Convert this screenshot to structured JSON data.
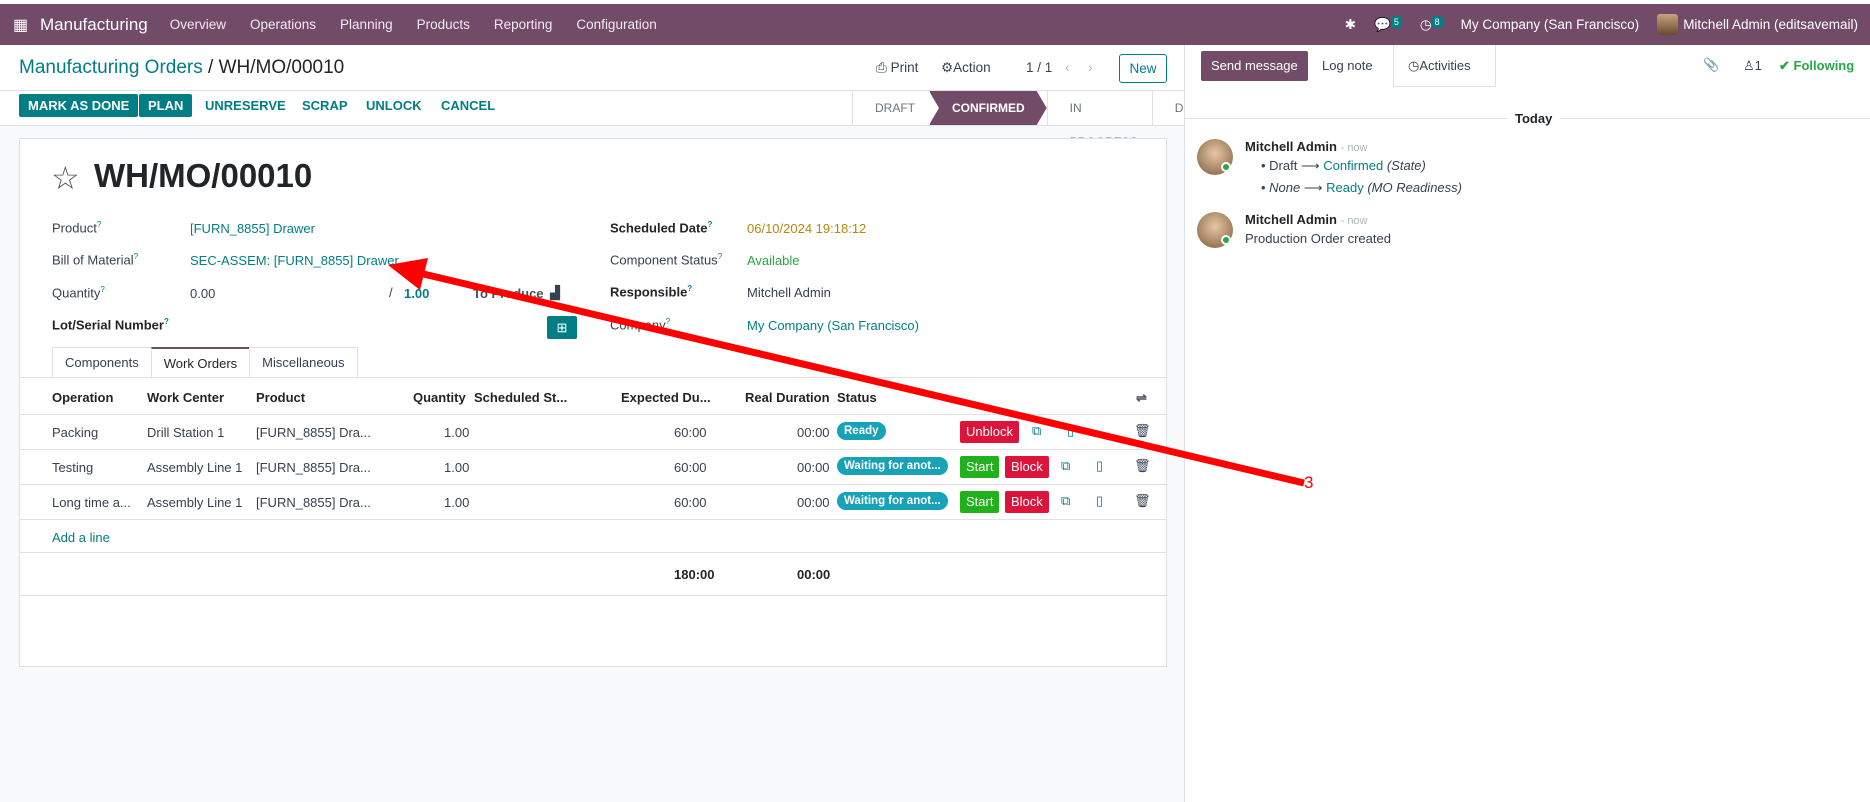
{
  "topbar": {
    "app_name": "Manufacturing",
    "menu": [
      "Overview",
      "Operations",
      "Planning",
      "Products",
      "Reporting",
      "Configuration"
    ],
    "chat_count": "5",
    "activity_count": "8",
    "company": "My Company (San Francisco)",
    "user": "Mitchell Admin (editsavemail)"
  },
  "control": {
    "breadcrumb_parent": "Manufacturing Orders",
    "breadcrumb_sep": "/",
    "breadcrumb_current": "WH/MO/00010",
    "print": "Print",
    "action": "Action",
    "pager": "1 / 1",
    "new": "New"
  },
  "actions": [
    "MARK AS DONE",
    "PLAN",
    "UNRESERVE",
    "SCRAP",
    "UNLOCK",
    "CANCEL"
  ],
  "stages": [
    "DRAFT",
    "CONFIRMED",
    "IN PROGRESS",
    "DONE"
  ],
  "form": {
    "title": "WH/MO/00010",
    "product_label": "Product",
    "product": "[FURN_8855] Drawer",
    "bom_label": "Bill of Material",
    "bom": "SEC-ASSEM: [FURN_8855] Drawer",
    "qty_label": "Quantity",
    "qty_done": "0.00",
    "qty_sep": "/",
    "qty_total": "1.00",
    "to_produce": "To Produce",
    "lot_label": "Lot/Serial Number",
    "sched_label": "Scheduled Date",
    "sched": "06/10/2024 19:18:12",
    "comp_status_label": "Component Status",
    "comp_status": "Available",
    "resp_label": "Responsible",
    "resp": "Mitchell Admin",
    "company_label": "Company",
    "company": "My Company (San Francisco)"
  },
  "tabs": [
    "Components",
    "Work Orders",
    "Miscellaneous"
  ],
  "table": {
    "headers": [
      "Operation",
      "Work Center",
      "Product",
      "Quantity",
      "Scheduled St...",
      "Expected Du...",
      "Real Duration",
      "Status"
    ],
    "rows": [
      {
        "op": "Packing",
        "wc": "Drill Station 1",
        "product": "[FURN_8855] Dra...",
        "qty": "1.00",
        "exp": "60:00",
        "real": "00:00",
        "status": "Ready",
        "btn1": "Unblock",
        "btn2": ""
      },
      {
        "op": "Testing",
        "wc": "Assembly Line 1",
        "product": "[FURN_8855] Dra...",
        "qty": "1.00",
        "exp": "60:00",
        "real": "00:00",
        "status": "Waiting for anot...",
        "btn1": "Start",
        "btn2": "Block"
      },
      {
        "op": "Long time a...",
        "wc": "Assembly Line 1",
        "product": "[FURN_8855] Dra...",
        "qty": "1.00",
        "exp": "60:00",
        "real": "00:00",
        "status": "Waiting for anot...",
        "btn1": "Start",
        "btn2": "Block"
      }
    ],
    "add_line": "Add a line",
    "total_expected": "180:00",
    "total_real": "00:00"
  },
  "chatter": {
    "send": "Send message",
    "log": "Log note",
    "activities": "Activities",
    "followers": "1",
    "following": "Following",
    "today": "Today",
    "m1_author": "Mitchell Admin",
    "m1_time": "- now",
    "m1_l1_from": "Draft",
    "m1_l1_to": "Confirmed",
    "m1_l1_field": "(State)",
    "m1_l2_from": "None",
    "m1_l2_to": "Ready",
    "m1_l2_field": "(MO Readiness)",
    "m2_author": "Mitchell Admin",
    "m2_time": "- now",
    "m2_text": "Production Order created"
  },
  "annotation": {
    "label": "3",
    "color": "#ff0000"
  }
}
